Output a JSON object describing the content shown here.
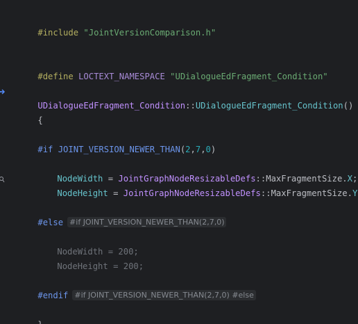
{
  "code": {
    "include_kw": "#include",
    "include_file": "\"JointVersionComparison.h\"",
    "define_kw": "#define",
    "define_name": "LOCTEXT_NAMESPACE",
    "define_value": "\"UDialogueEdFragment_Condition\"",
    "ctor_class": "UDialogueEdFragment_Condition",
    "ctor_sep": "::",
    "ctor_name": "UDialogueEdFragment_Condition",
    "ctor_parens": "()",
    "open_brace": "{",
    "if_kw": "#if",
    "if_macro": "JOINT_VERSION_NEWER_THAN",
    "if_args_open": "(",
    "if_arg1": "2",
    "if_arg2": "7",
    "if_arg3": "0",
    "comma": ",",
    "if_args_close": ")",
    "line1_member": "NodeWidth",
    "assign": " = ",
    "defs_class": "JointGraphNodeResizableDefs",
    "scope": "::",
    "max_size": "MaxFragmentSize",
    "dot": ".",
    "line1_field": "X",
    "semicolon": ";",
    "line2_member": "NodeHeight",
    "line2_field": "Y",
    "else_kw": "#else",
    "else_hint": "#if JOINT_VERSION_NEWER_THAN(2,7,0)",
    "inactive_line1": "NodeWidth = 200;",
    "inactive_line2": "NodeHeight = 200;",
    "endif_kw": "#endif",
    "endif_hint": "#if JOINT_VERSION_NEWER_THAN(2,7,0) #else",
    "close_brace": "}"
  },
  "icons": {
    "ctor_gutter": "navigate-to-declaration-icon",
    "member_gutter": "inspect-icon"
  },
  "colors": {
    "background": "#1e1f22",
    "preprocessor": "#b3ae60",
    "string": "#6aab73",
    "class": "#c191ff",
    "member": "#66c3cc",
    "number": "#2aacb8",
    "inactive": "#6f737a"
  }
}
